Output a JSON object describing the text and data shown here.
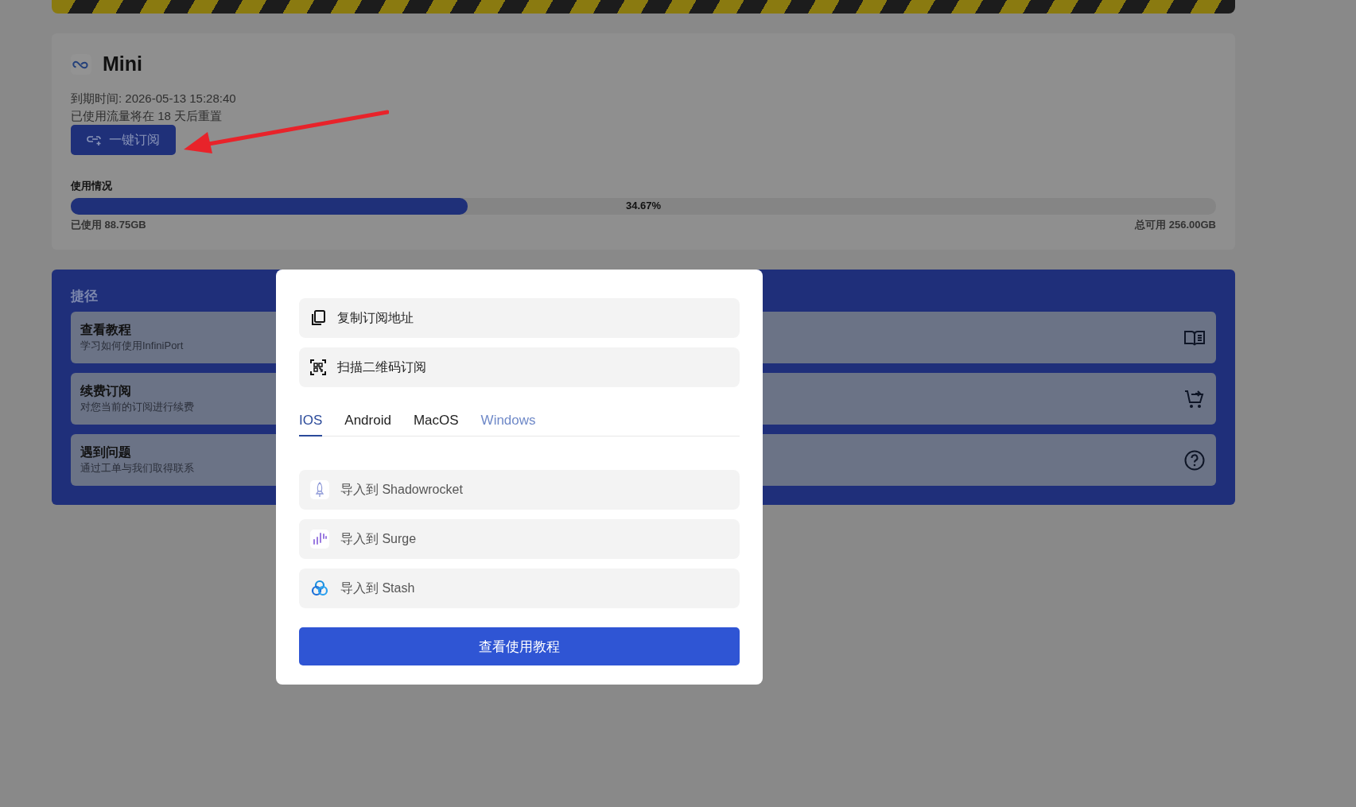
{
  "plan": {
    "name": "Mini",
    "expiry": "到期时间: 2026-05-13 15:28:40",
    "reset_note": "已使用流量将在 18 天后重置",
    "subscribe_button": "一键订阅"
  },
  "usage": {
    "title": "使用情况",
    "level": 0.3467,
    "percent": "34.67%",
    "used": "已使用 88.75GB",
    "total": "总可用 256.00GB"
  },
  "shortcuts": {
    "title": "捷径",
    "items": [
      {
        "kind": "book",
        "title": "查看教程",
        "subtitle": "学习如何使用InfiniPort"
      },
      {
        "kind": "cart",
        "title": "续费订阅",
        "subtitle": "对您当前的订阅进行续费"
      },
      {
        "kind": "help",
        "title": "遇到问题",
        "subtitle": "通过工单与我们取得联系"
      }
    ]
  },
  "dialog": {
    "actions": [
      {
        "kind": "copy",
        "label": "复制订阅地址"
      },
      {
        "kind": "qr",
        "label": "扫描二维码订阅"
      }
    ],
    "tabs": [
      {
        "label": "IOS",
        "selected": true,
        "hovered": false
      },
      {
        "label": "Android",
        "selected": false,
        "hovered": false
      },
      {
        "label": "MacOS",
        "selected": false,
        "hovered": false
      },
      {
        "label": "Windows",
        "selected": false,
        "hovered": true
      }
    ],
    "imports": [
      {
        "kind": "rocket",
        "label": "导入到 Shadowrocket"
      },
      {
        "kind": "surge",
        "label": "导入到 Surge"
      },
      {
        "kind": "stash",
        "label": "导入到 Stash"
      }
    ],
    "button": "查看使用教程"
  }
}
